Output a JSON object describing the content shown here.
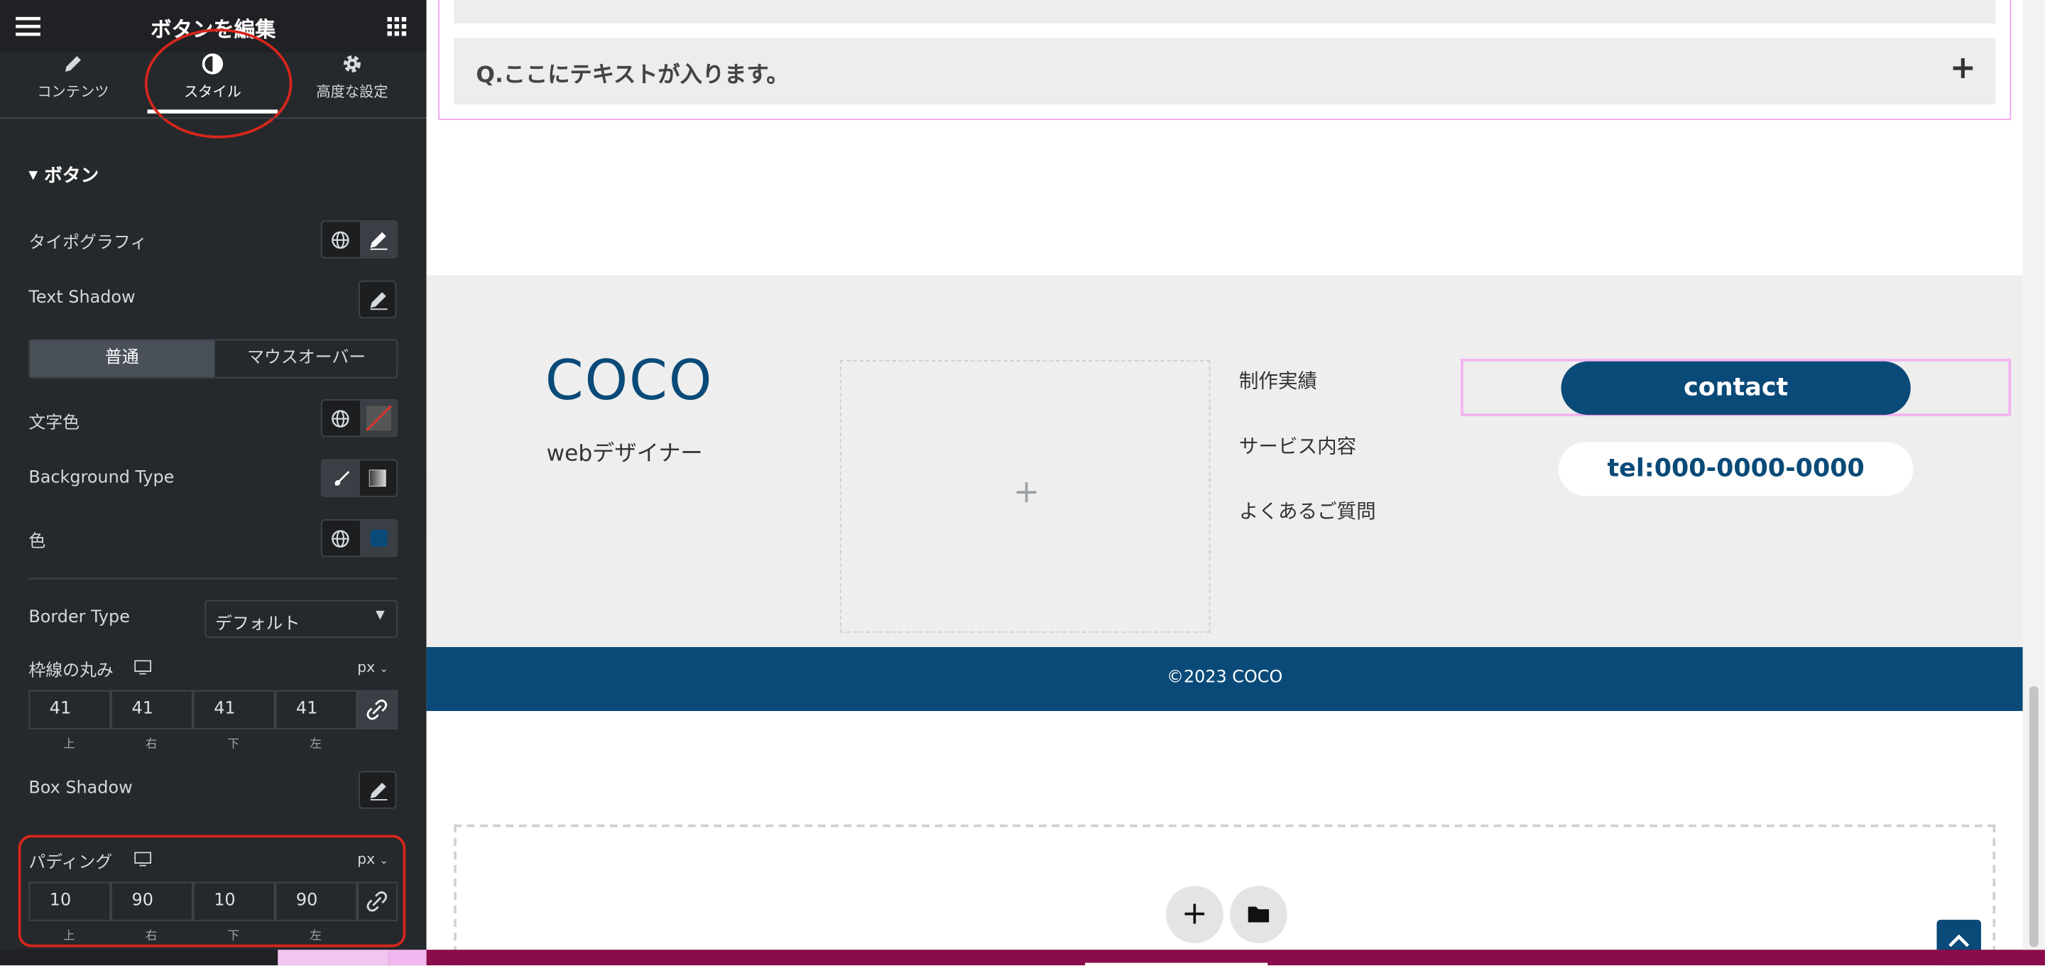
{
  "panel": {
    "title": "ボタンを編集",
    "tabs": [
      {
        "label": "コンテンツ",
        "icon": "pencil-icon"
      },
      {
        "label": "スタイル",
        "icon": "contrast-icon",
        "active": true
      },
      {
        "label": "高度な設定",
        "icon": "gear-icon"
      }
    ],
    "section_title": "ボタン",
    "typography_label": "タイポグラフィ",
    "text_shadow_label": "Text Shadow",
    "state_tabs": [
      "普通",
      "マウスオーバー"
    ],
    "text_color_label": "文字色",
    "background_type_label": "Background Type",
    "color_label": "色",
    "color_value": "#0a4a78",
    "border_type_label": "Border Type",
    "border_type_value": "デフォルト",
    "border_radius_label": "枠線の丸み",
    "border_radius_unit": "px",
    "border_radius_values": [
      "41",
      "41",
      "41",
      "41"
    ],
    "side_labels": [
      "上",
      "右",
      "下",
      "左"
    ],
    "box_shadow_label": "Box Shadow",
    "padding_label": "パディング",
    "padding_unit": "px",
    "padding_values": [
      "10",
      "90",
      "10",
      "90"
    ]
  },
  "canvas": {
    "faq_item_text": "Q.ここにテキストが入ります。",
    "faq_toggle": "+",
    "footer": {
      "logo": "COCO",
      "tagline": "webデザイナー",
      "links": [
        "制作実績",
        "サービス内容",
        "よくあるご質問"
      ],
      "contact_button": "contact",
      "tel_button": "tel:000-0000-0000",
      "copyright": "©2023 COCO"
    },
    "brand_color": "#0a4a78",
    "add_section_plus": "+"
  }
}
